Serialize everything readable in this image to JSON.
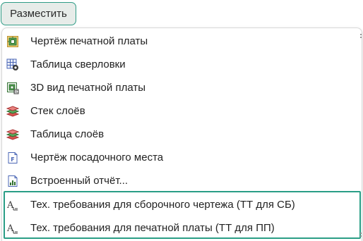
{
  "place_button": {
    "label": "Разместить"
  },
  "menu": {
    "items": [
      {
        "label": "Чертёж печатной платы",
        "icon": "board-drawing-icon"
      },
      {
        "label": "Таблица сверловки",
        "icon": "drill-table-icon"
      },
      {
        "label": "3D вид печатной платы",
        "icon": "board-3d-view-icon"
      },
      {
        "label": "Стек слоёв",
        "icon": "layer-stack-icon"
      },
      {
        "label": "Таблица слоёв",
        "icon": "layer-table-icon"
      },
      {
        "label": "Чертёж посадочного места",
        "icon": "footprint-drawing-icon"
      },
      {
        "label": "Встроенный отчёт...",
        "icon": "embedded-report-icon"
      },
      {
        "label": "Тех. требования для сборочного чертежа (ТТ для СБ)",
        "icon": "text-requirements-icon"
      },
      {
        "label": "Тех. требования для печатной платы (ТТ для ПП)",
        "icon": "text-requirements-icon"
      }
    ]
  },
  "colors": {
    "accent": "#2a9e86",
    "button_bg": "#e7ece9"
  }
}
